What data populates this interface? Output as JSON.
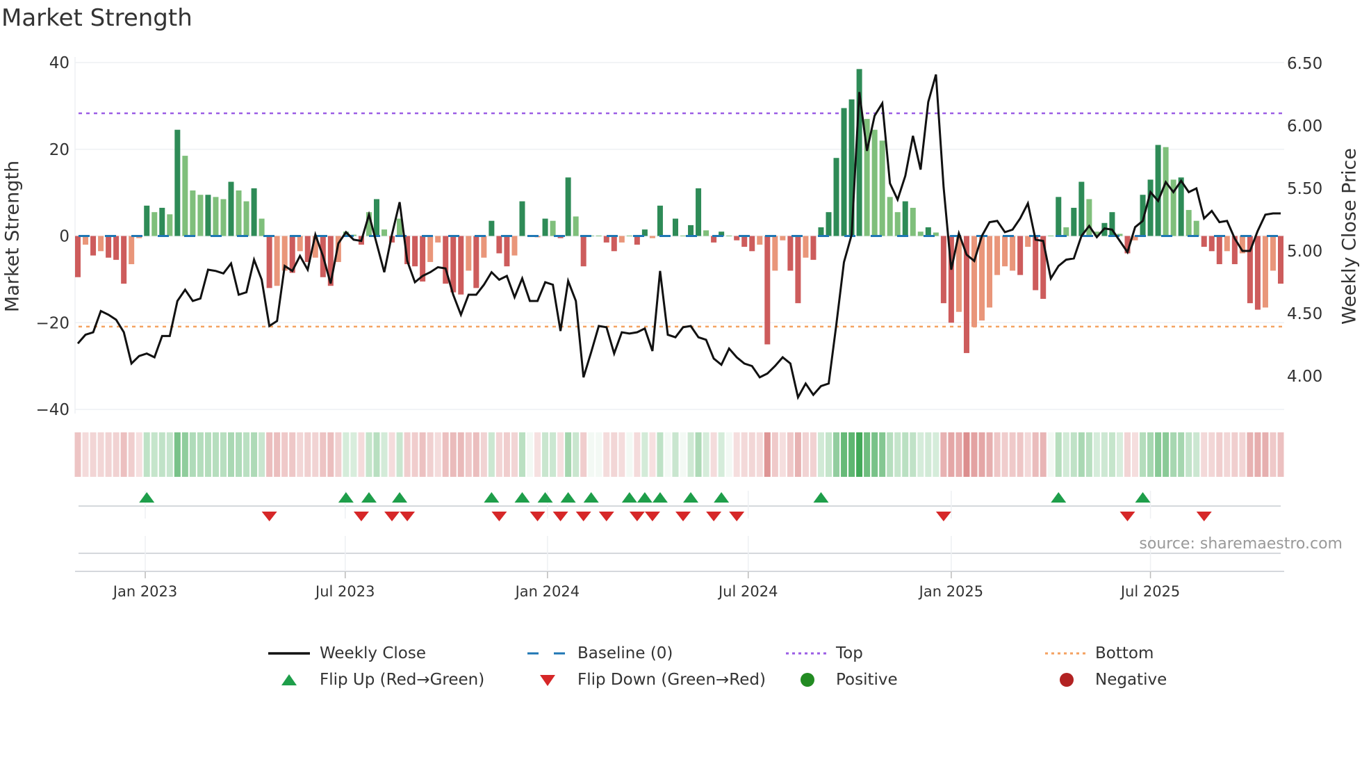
{
  "chart_data": {
    "type": "bar",
    "title": "Market Strength",
    "ylabel": "Market Strength",
    "ylabel_right": "Weekly Close Price",
    "ylim": [
      -40,
      40
    ],
    "yticks": [
      40,
      20,
      0,
      -20,
      -40
    ],
    "ytick_labels": [
      "40",
      "20",
      "0",
      "−20",
      "−40"
    ],
    "ylim_right": [
      3.71,
      6.51
    ],
    "yticks_right": [
      6.5,
      6.0,
      5.5,
      5.0,
      4.5,
      4.0
    ],
    "ytick_right_labels": [
      "6.50",
      "6.00",
      "5.50",
      "5.00",
      "4.50",
      "4.00"
    ],
    "xticks": [
      {
        "week": 8.8,
        "label": "Jan 2023"
      },
      {
        "week": 34.9,
        "label": "Jul 2023"
      },
      {
        "week": 61.3,
        "label": "Jan 2024"
      },
      {
        "week": 87.5,
        "label": "Jul 2024"
      },
      {
        "week": 114,
        "label": "Jan 2025"
      },
      {
        "week": 140,
        "label": "Jul 2025"
      }
    ],
    "top_level": 28.3,
    "bottom_level": -20.9,
    "baseline": 0,
    "grid": true,
    "legend_position": "bottom",
    "strength": [
      -9.5,
      -2,
      -4.5,
      -3.5,
      -5,
      -5.5,
      -11,
      -6.5,
      -0.5,
      7,
      5.5,
      6.5,
      5,
      24.5,
      18.5,
      10.5,
      9.5,
      9.5,
      9,
      8.5,
      12.5,
      10.5,
      8,
      11,
      4,
      -12,
      -11.5,
      -8,
      -8.5,
      -3.5,
      -6,
      -5,
      -9.5,
      -11.5,
      -6,
      1,
      0.3,
      -2,
      5.5,
      8.5,
      1.5,
      -1.5,
      4,
      -6.5,
      -7,
      -10.5,
      -6,
      -1.5,
      -11,
      -13,
      -13.5,
      -8,
      -12,
      -5,
      3.5,
      -4,
      -7,
      -4.5,
      8,
      0.1,
      -0.3,
      4,
      3.5,
      -0.5,
      13.5,
      4.5,
      -7,
      0.1,
      0.1,
      -1.5,
      -3.5,
      -1.5,
      0.1,
      -2,
      1.5,
      -0.5,
      7,
      0.1,
      4,
      0.1,
      2.5,
      11,
      1.3,
      -1.5,
      1,
      0.1,
      -1,
      -2.5,
      -3.5,
      -2,
      -25,
      -8,
      -1,
      -8,
      -15.5,
      -5,
      -5.5,
      2,
      5.5,
      18,
      29.5,
      31.5,
      38.5,
      27,
      24.5,
      22,
      9,
      5.5,
      8,
      6.5,
      1,
      2,
      0.8,
      -15.5,
      -20,
      -17.5,
      -27,
      -21,
      -19.5,
      -16.5,
      -9,
      -7,
      -8,
      -9,
      -2.5,
      -12.5,
      -14.5,
      0.1,
      9,
      2,
      6.5,
      12.5,
      8.5,
      1,
      3,
      5.5,
      0.5,
      -4,
      -1,
      9.5,
      13,
      21,
      20.5,
      13,
      13.5,
      6,
      3.5,
      -2.5,
      -3.5,
      -6.5,
      -3.5,
      -6.5,
      -4,
      -15.5,
      -17,
      -16.5,
      -8,
      -11
    ],
    "shade": "SWSWSSSWWSWSWSWWWSWWSWWSWSWWSWSWSSWWWSWSWSWSSSWWSSSWSWSSSWSWWSWSSWSWWSSWWSSWSWSWSSWSSWSSSWSWWSSWSSSSSSSWWWWWSWWSWSSWSWWWWWWSWSSWSWSSWWSSWSWSSSWWSWWSSSWSWSSWWS",
    "weekly_close": [
      4.26,
      4.33,
      4.35,
      4.52,
      4.49,
      4.45,
      4.35,
      4.1,
      4.16,
      4.18,
      4.15,
      4.32,
      4.32,
      4.6,
      4.69,
      4.6,
      4.62,
      4.85,
      4.84,
      4.82,
      4.9,
      4.65,
      4.67,
      4.93,
      4.77,
      4.4,
      4.44,
      4.88,
      4.84,
      4.96,
      4.85,
      5.13,
      4.96,
      4.74,
      5.06,
      5.15,
      5.09,
      5.08,
      5.29,
      5.06,
      4.83,
      5.13,
      5.39,
      4.92,
      4.75,
      4.8,
      4.83,
      4.87,
      4.86,
      4.65,
      4.49,
      4.65,
      4.65,
      4.73,
      4.83,
      4.77,
      4.8,
      4.63,
      4.78,
      4.6,
      4.6,
      4.75,
      4.73,
      4.36,
      4.76,
      4.6,
      3.99,
      4.19,
      4.4,
      4.39,
      4.18,
      4.35,
      4.34,
      4.35,
      4.38,
      4.2,
      4.84,
      4.33,
      4.31,
      4.39,
      4.4,
      4.31,
      4.29,
      4.14,
      4.09,
      4.22,
      4.15,
      4.1,
      4.08,
      3.99,
      4.02,
      4.08,
      4.15,
      4.1,
      3.83,
      3.94,
      3.85,
      3.92,
      3.94,
      4.41,
      4.91,
      5.13,
      6.27,
      5.8,
      6.08,
      6.18,
      5.54,
      5.41,
      5.6,
      5.92,
      5.65,
      6.19,
      6.41,
      5.51,
      4.85,
      5.14,
      4.97,
      4.92,
      5.12,
      5.23,
      5.24,
      5.15,
      5.17,
      5.26,
      5.38,
      5.09,
      5.08,
      4.78,
      4.88,
      4.93,
      4.94,
      5.12,
      5.2,
      5.11,
      5.18,
      5.17,
      5.08,
      4.99,
      5.19,
      5.24,
      5.47,
      5.4,
      5.55,
      5.47,
      5.56,
      5.47,
      5.5,
      5.26,
      5.32,
      5.23,
      5.24,
      5.1,
      5.0,
      5.0,
      5.16,
      5.29,
      5.3,
      5.3
    ],
    "flip_up_weeks": [
      9,
      35,
      38,
      42,
      54,
      58,
      61,
      64,
      67,
      72,
      74,
      76,
      80,
      84,
      97,
      128,
      139
    ],
    "flip_down_weeks": [
      25,
      37,
      41,
      43,
      55,
      60,
      63,
      66,
      69,
      73,
      75,
      79,
      83,
      86,
      113,
      137,
      147
    ]
  },
  "colors": {
    "pos_strong": "#2e8b57",
    "pos_weak": "#7fbf7b",
    "neg_strong": "#cd5c5c",
    "neg_weak": "#e9967a",
    "line": "#111111",
    "baseline": "#1f77b4",
    "top": "#9b5de5",
    "bottom": "#f4a261",
    "flip_up": "#1e9e4a",
    "flip_down": "#d62728",
    "positive": "#228b22",
    "negative": "#b22222"
  },
  "source": "source: sharemaestro.com",
  "legend": {
    "weekly_close": "Weekly Close",
    "baseline": "Baseline (0)",
    "top": "Top",
    "bottom": "Bottom",
    "flip_up": "Flip Up (Red→Green)",
    "flip_down": "Flip Down (Green→Red)",
    "positive": "Positive",
    "negative": "Negative"
  }
}
